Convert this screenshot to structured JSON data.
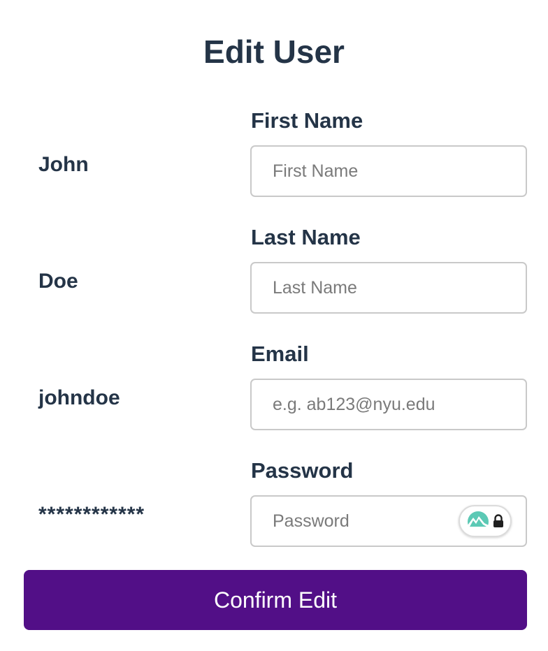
{
  "page": {
    "title": "Edit User"
  },
  "fields": {
    "first_name": {
      "current_value": "John",
      "label": "First Name",
      "input_value": "",
      "placeholder": "First Name"
    },
    "last_name": {
      "current_value": "Doe",
      "label": "Last Name",
      "input_value": "",
      "placeholder": "Last Name"
    },
    "email": {
      "current_value": "johndoe",
      "label": "Email",
      "input_value": "",
      "placeholder": "e.g. ab123@nyu.edu"
    },
    "password": {
      "current_value": "************",
      "label": "Password",
      "input_value": "",
      "placeholder": "Password",
      "manager_icon": "password-manager-icon"
    }
  },
  "actions": {
    "confirm_label": "Confirm Edit"
  },
  "colors": {
    "primary_button": "#520f87",
    "text": "#243447",
    "input_border": "#c9c9c9",
    "manager_mountain": "#5cc9b5"
  }
}
